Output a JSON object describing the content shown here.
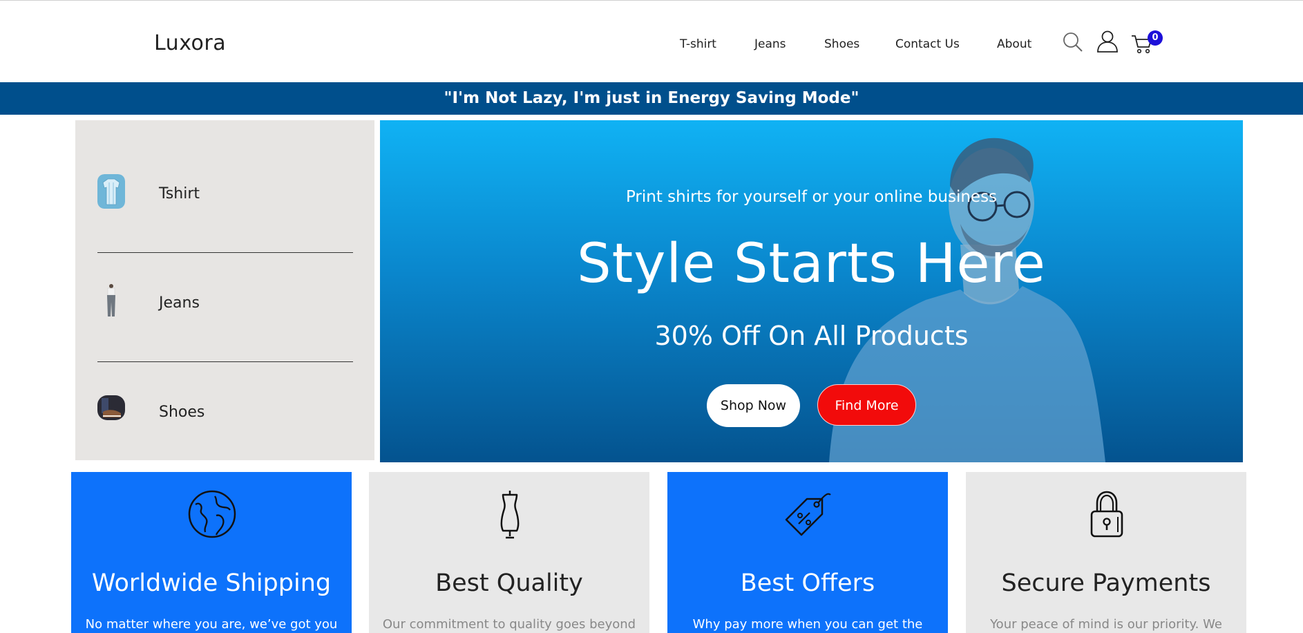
{
  "brand": {
    "logo": "Luxora"
  },
  "nav": {
    "items": [
      {
        "label": "T-shirt"
      },
      {
        "label": "Jeans"
      },
      {
        "label": "Shoes"
      },
      {
        "label": "Contact Us"
      },
      {
        "label": "About"
      }
    ],
    "icons": [
      "search-icon",
      "user-icon",
      "cart-icon"
    ],
    "cart_count": "0"
  },
  "promo": {
    "text": "\"I'm Not Lazy, I'm just in Energy Saving Mode\""
  },
  "sidebar": {
    "categories": [
      {
        "label": "Tshirt",
        "icon": "tshirt-thumbnail"
      },
      {
        "label": "Jeans",
        "icon": "jeans-thumbnail"
      },
      {
        "label": "Shoes",
        "icon": "shoes-thumbnail"
      }
    ]
  },
  "hero": {
    "subtitle": "Print shirts for yourself or your online business",
    "title": "Style Starts Here",
    "offer": "30% Off On All Products",
    "primary_button": "Shop Now",
    "secondary_button": "Find More"
  },
  "features": [
    {
      "title": "Worldwide Shipping",
      "description": "No matter where you are, we’ve got you",
      "icon": "globe-icon",
      "style": "blue"
    },
    {
      "title": "Best Quality",
      "description": "Our commitment to quality goes beyond",
      "icon": "mannequin-icon",
      "style": "grey"
    },
    {
      "title": "Best Offers",
      "description": "Why pay more when you can get the",
      "icon": "price-tag-icon",
      "style": "blue"
    },
    {
      "title": "Secure Payments",
      "description": "Your peace of mind is our priority. We",
      "icon": "lock-icon",
      "style": "grey"
    }
  ],
  "colors": {
    "promo_bar": "#004f8c",
    "hero_top": "#10b2f4",
    "hero_bottom": "#04538f",
    "feature_blue": "#0d72fb",
    "feature_grey": "#e8e8e8",
    "find_more": "#f20b0b",
    "cart_badge": "#1d10d9"
  }
}
